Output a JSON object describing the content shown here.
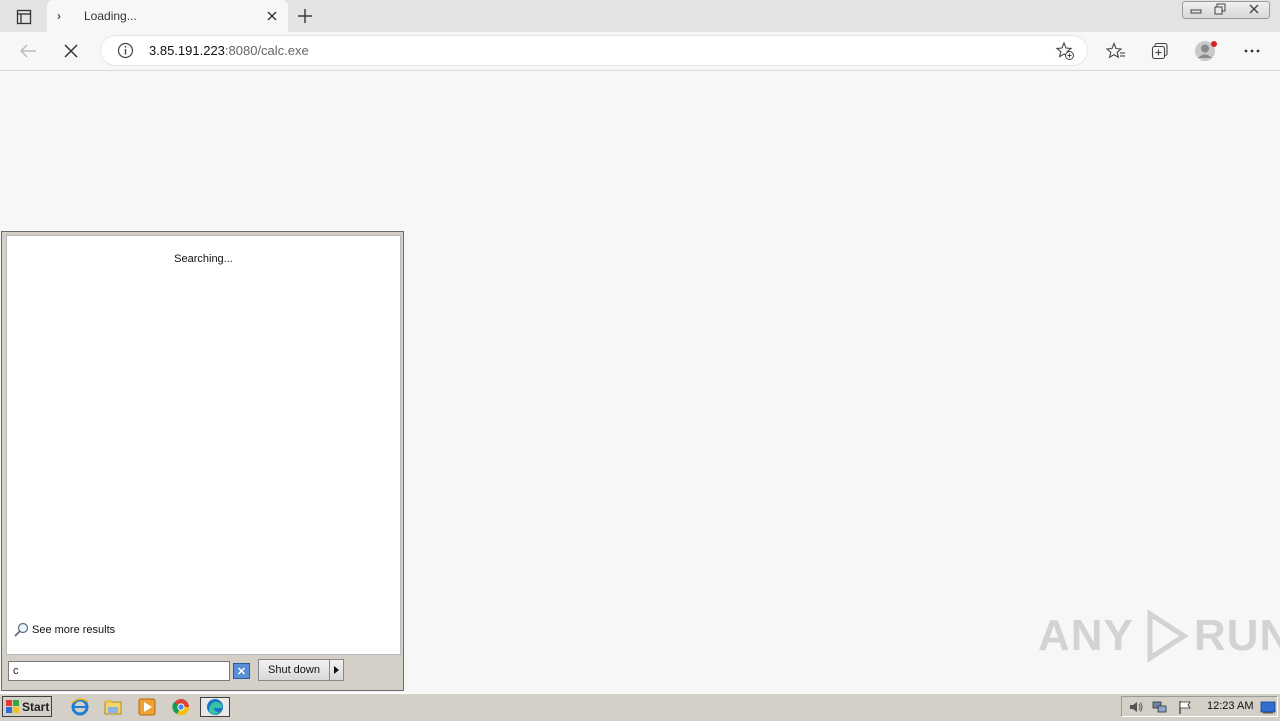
{
  "browser": {
    "tab": {
      "title": "Loading...",
      "spinner_glyph": "›"
    },
    "address": {
      "host": "3.85.191.223",
      "rest": ":8080/calc.exe"
    }
  },
  "start_menu": {
    "status": "Searching...",
    "see_more": "See more results",
    "search_value": "c",
    "shutdown_label": "Shut down"
  },
  "taskbar": {
    "start_label": "Start",
    "clock": "12:23 AM"
  },
  "watermark": {
    "left": "ANY",
    "right": "RUN"
  },
  "colors": {
    "accent": "#0078d4",
    "edge_teal": "#1fb6a6",
    "taskbar": "#d4d0c8"
  }
}
